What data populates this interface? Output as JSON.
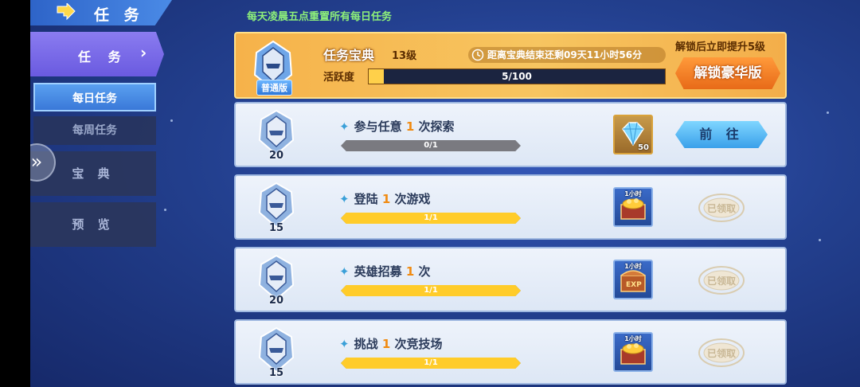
{
  "header": {
    "title": "任 务",
    "notice": "每天凌晨五点重置所有每日任务"
  },
  "sidebar": {
    "main": {
      "label": "任 务"
    },
    "sub": [
      {
        "label": "每日任务",
        "active": true
      },
      {
        "label": "每周任务",
        "active": false
      }
    ],
    "sections": [
      {
        "label": "宝 典"
      },
      {
        "label": "预 览"
      }
    ]
  },
  "pass": {
    "edition": "普通版",
    "name": "任务宝典",
    "level": "13级",
    "timer": "距离宝典结束还剩09天11小时56分",
    "activity_label": "活跃度",
    "activity_text": "5/100",
    "activity_current": 5,
    "activity_max": 100,
    "unlock_tip": "解锁后立即提升5级",
    "unlock_button": "解锁豪华版"
  },
  "tasks": [
    {
      "points": "20",
      "prefix": "参与任意",
      "count": "1",
      "suffix": "次探索",
      "progress_text": "0/1",
      "progress": 0,
      "reward_type": "gem",
      "reward_qty": "50",
      "reward_tag": "",
      "action": "前 往",
      "claimed": false
    },
    {
      "points": "15",
      "prefix": "登陆",
      "count": "1",
      "suffix": "次游戏",
      "progress_text": "1/1",
      "progress": 1,
      "reward_type": "gold-chest",
      "reward_qty": "",
      "reward_tag": "1小时",
      "action": "已领取",
      "claimed": true
    },
    {
      "points": "20",
      "prefix": "英雄招募",
      "count": "1",
      "suffix": "次",
      "progress_text": "1/1",
      "progress": 1,
      "reward_type": "exp-chest",
      "reward_qty": "",
      "reward_tag": "1小时",
      "action": "已领取",
      "claimed": true
    },
    {
      "points": "15",
      "prefix": "挑战",
      "count": "1",
      "suffix": "次竞技场",
      "progress_text": "1/1",
      "progress": 1,
      "reward_type": "gold-chest",
      "reward_qty": "",
      "reward_tag": "1小时",
      "action": "已领取",
      "claimed": true
    }
  ],
  "colors": {
    "accent_orange": "#f08a10",
    "progress_yellow": "#ffcc2a",
    "notice_green": "#8ef07a"
  }
}
